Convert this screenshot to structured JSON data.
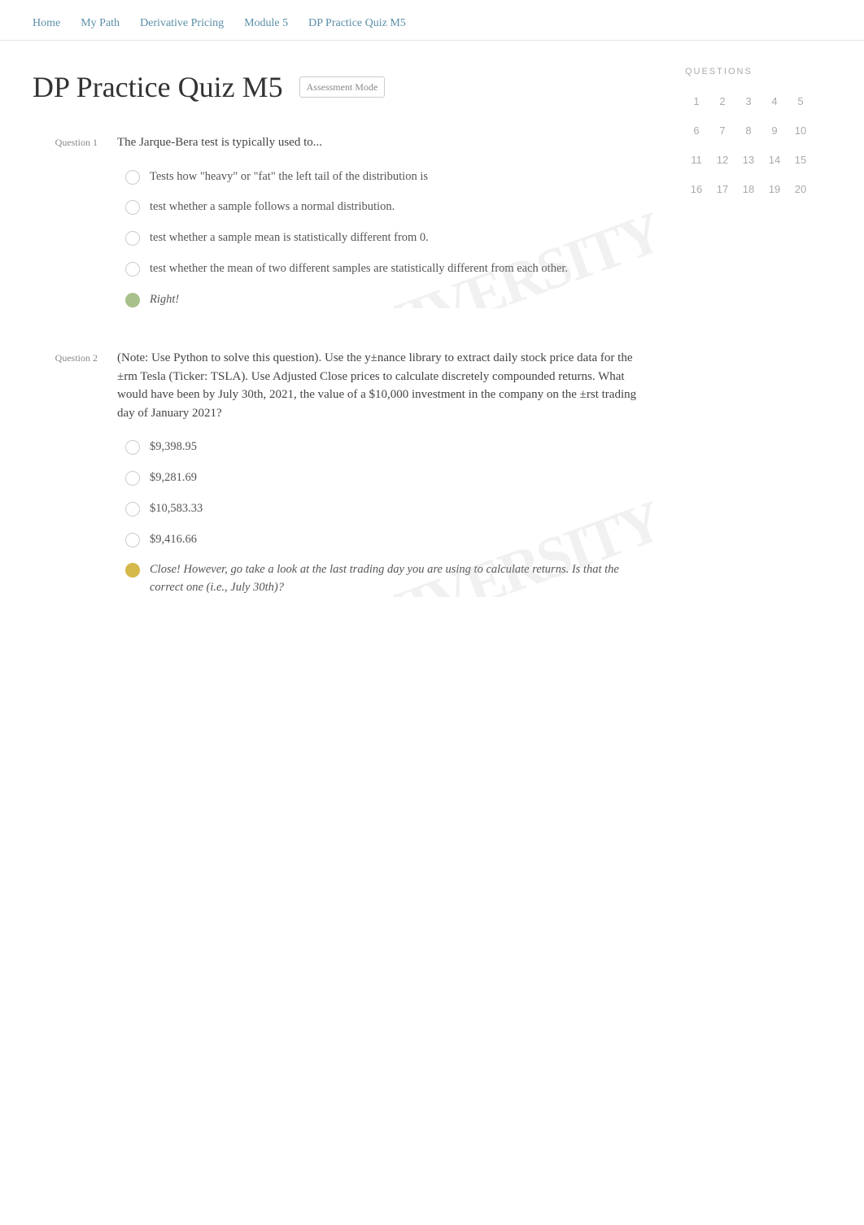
{
  "breadcrumb": {
    "items": [
      "Home",
      "My Path",
      "Derivative Pricing",
      "Module 5",
      "DP Practice Quiz M5"
    ],
    "separators": [
      ">",
      ">",
      ">",
      ">"
    ]
  },
  "page": {
    "title": "DP Practice Quiz M5",
    "badge": "Assessment Mode"
  },
  "sidebar": {
    "header": "QUESTIONS",
    "numbers": [
      1,
      2,
      3,
      4,
      5,
      6,
      7,
      8,
      9,
      10,
      11,
      12,
      13,
      14,
      15,
      16,
      17,
      18,
      19,
      20
    ]
  },
  "questions": [
    {
      "label": "Question 1",
      "text": "The Jarque-Bera test is typically used to...",
      "options": [
        {
          "text": "Tests how \"heavy\" or \"fat\" the left tail of the distribution is",
          "indicator": "empty"
        },
        {
          "text": "test whether a sample follows a normal distribution.",
          "indicator": "empty"
        },
        {
          "text": "test whether a sample mean is statistically different from 0.",
          "indicator": "empty"
        },
        {
          "text": "test whether the mean of two different samples are statistically different from each other.",
          "indicator": "empty"
        },
        {
          "text": "Right!",
          "indicator": "selected-green"
        }
      ]
    },
    {
      "label": "Question 2",
      "text": "(Note:  Use Python to solve this question). Use the y±nance library   to extract daily stock price data for the ±rm Tesla (Ticker: TSLA). Use Adjusted Close prices to calculate discretely compounded returns. What would have been by July 30th, 2021, the value of a $10,000 investment in the company on the ±rst trading day of January 2021?",
      "options": [
        {
          "text": "$9,398.95",
          "indicator": "empty"
        },
        {
          "text": "$9,281.69",
          "indicator": "empty"
        },
        {
          "text": "$10,583.33",
          "indicator": "empty"
        },
        {
          "text": "$9,416.66",
          "indicator": "empty"
        },
        {
          "text": "Close! However, go take a look at the last trading day you are using to calculate returns. Is that the correct one (i.e., July 30th)?",
          "indicator": "selected-yellow"
        }
      ]
    }
  ]
}
